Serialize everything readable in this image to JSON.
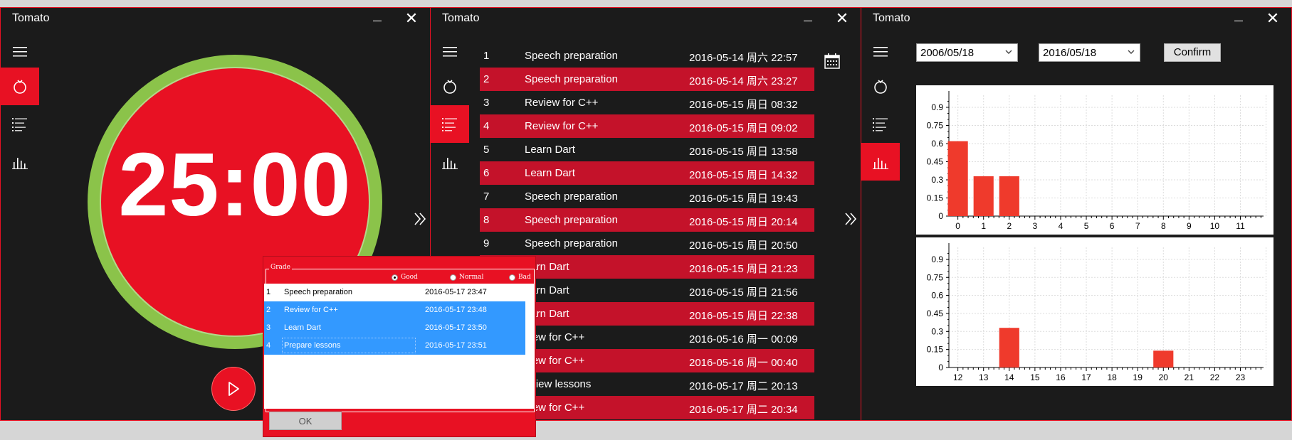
{
  "app_title": "Tomato",
  "timer": {
    "time": "25:00"
  },
  "grade_dialog": {
    "legend": "Grade",
    "options": [
      {
        "label": "Good",
        "checked": true
      },
      {
        "label": "Normal",
        "checked": false
      },
      {
        "label": "Bad",
        "checked": false
      }
    ],
    "rows": [
      {
        "n": "1",
        "task": "Speech preparation",
        "date": "2016-05-17 23:47",
        "selected": false
      },
      {
        "n": "2",
        "task": "Review for C++",
        "date": "2016-05-17 23:48",
        "selected": true
      },
      {
        "n": "3",
        "task": "Learn Dart",
        "date": "2016-05-17 23:50",
        "selected": true
      },
      {
        "n": "4",
        "task": "Prepare lessons",
        "date": "2016-05-17 23:51",
        "selected": true
      }
    ],
    "ok_label": "OK"
  },
  "history": [
    {
      "n": "1",
      "task": "Speech preparation",
      "date": "2016-05-14 周六 22:57"
    },
    {
      "n": "2",
      "task": "Speech preparation",
      "date": "2016-05-14 周六 23:27"
    },
    {
      "n": "3",
      "task": "Review for C++",
      "date": "2016-05-15 周日 08:32"
    },
    {
      "n": "4",
      "task": "Review for C++",
      "date": "2016-05-15 周日 09:02"
    },
    {
      "n": "5",
      "task": "Learn Dart",
      "date": "2016-05-15 周日 13:58"
    },
    {
      "n": "6",
      "task": "Learn Dart",
      "date": "2016-05-15 周日 14:32"
    },
    {
      "n": "7",
      "task": "Speech preparation",
      "date": "2016-05-15 周日 19:43"
    },
    {
      "n": "8",
      "task": "Speech preparation",
      "date": "2016-05-15 周日 20:14"
    },
    {
      "n": "9",
      "task": "Speech preparation",
      "date": "2016-05-15 周日 20:50"
    },
    {
      "n": "",
      "task": "earn Dart",
      "date": "2016-05-15 周日 21:23"
    },
    {
      "n": "",
      "task": "earn Dart",
      "date": "2016-05-15 周日 21:56"
    },
    {
      "n": "",
      "task": "earn Dart",
      "date": "2016-05-15 周日 22:38"
    },
    {
      "n": "",
      "task": "view for C++",
      "date": "2016-05-16 周一 00:09"
    },
    {
      "n": "",
      "task": "view for C++",
      "date": "2016-05-16 周一 00:40"
    },
    {
      "n": "",
      "task": "eview lessons",
      "date": "2016-05-17 周二 20:13"
    },
    {
      "n": "",
      "task": "view for C++",
      "date": "2016-05-17 周二 20:34"
    }
  ],
  "stats": {
    "from_date": "2006/05/18",
    "to_date": "2016/05/18",
    "confirm_label": "Confirm"
  },
  "colors": {
    "accent": "#e81123",
    "ring": "#8bc34a",
    "selection": "#3399ff",
    "bar": "#ef3a2c"
  },
  "chart_data": [
    {
      "type": "bar",
      "categories": [
        "0",
        "1",
        "2",
        "3",
        "4",
        "5",
        "6",
        "7",
        "8",
        "9",
        "10",
        "11"
      ],
      "values": [
        0.62,
        0.33,
        0.33,
        0,
        0,
        0,
        0,
        0,
        0,
        0,
        0,
        0
      ],
      "yticks": [
        "0",
        "0.15",
        "0.3",
        "0.45",
        "0.6",
        "0.75",
        "0.9"
      ],
      "ylim": [
        0,
        1.0
      ],
      "grid": true
    },
    {
      "type": "bar",
      "categories": [
        "12",
        "13",
        "14",
        "15",
        "16",
        "17",
        "18",
        "19",
        "20",
        "21",
        "22",
        "23"
      ],
      "values": [
        0,
        0,
        0.33,
        0,
        0,
        0,
        0,
        0,
        0.14,
        0,
        0,
        0
      ],
      "yticks": [
        "0",
        "0.15",
        "0.3",
        "0.45",
        "0.6",
        "0.75",
        "0.9"
      ],
      "ylim": [
        0,
        1.0
      ],
      "grid": true
    }
  ]
}
